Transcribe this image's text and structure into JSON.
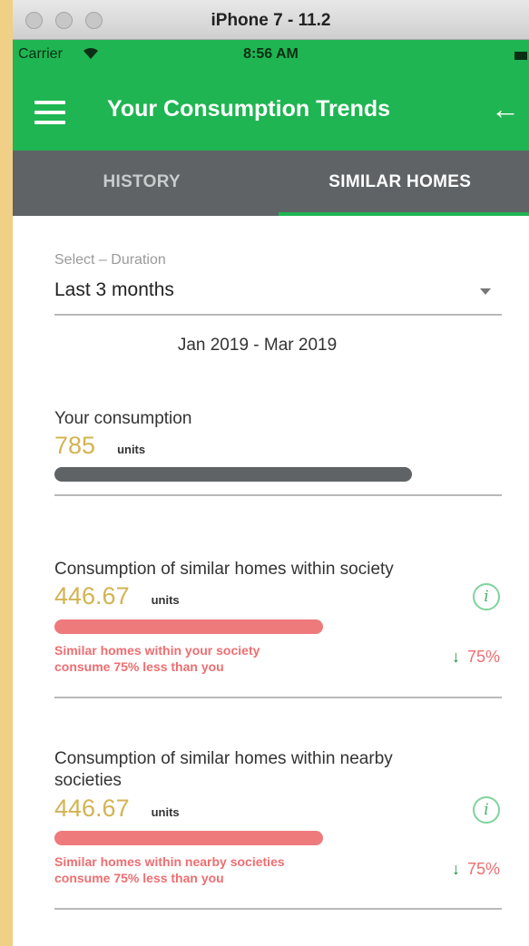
{
  "simulator": {
    "title": "iPhone 7 - 11.2"
  },
  "status_bar": {
    "carrier": "Carrier",
    "wifi_icon": "wifi-icon",
    "time": "8:56 AM"
  },
  "header": {
    "title": "Your Consumption Trends",
    "menu_icon": "menu-icon",
    "back_icon": "back-arrow-icon"
  },
  "tabs": [
    {
      "label": "HISTORY",
      "active": false
    },
    {
      "label": "SIMILAR HOMES",
      "active": true
    }
  ],
  "duration": {
    "label": "Select – Duration",
    "value": "Last 3 months",
    "range": "Jan 2019 - Mar 2019"
  },
  "your_consumption": {
    "title": "Your consumption",
    "value": "785",
    "unit": "units",
    "bar_fraction": 0.8
  },
  "society": {
    "title": "Consumption of similar homes within society",
    "value": "446.67",
    "unit": "units",
    "bar_fraction": 0.6,
    "note_line1": "Similar homes within your society",
    "note_line2": "consume 75% less than you",
    "percent": "75%"
  },
  "nearby": {
    "title_line1": "Consumption of similar homes within nearby",
    "title_line2": "societies",
    "value": "446.67",
    "unit": "units",
    "bar_fraction": 0.6,
    "note_line1": "Similar homes within nearby societies",
    "note_line2": "consume 75% less than you",
    "percent": "75%"
  },
  "colors": {
    "brand_green": "#1fb552",
    "tab_bg": "#5f6366",
    "value_gold": "#d3b352",
    "alert_red": "#ef6e71"
  }
}
